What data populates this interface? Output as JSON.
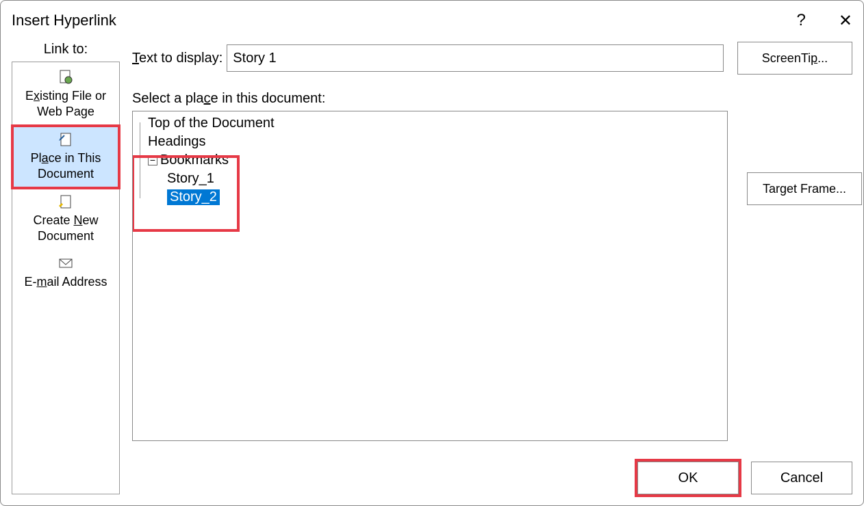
{
  "dialog": {
    "title": "Insert Hyperlink",
    "help_symbol": "?",
    "close_symbol": "✕"
  },
  "sidebar": {
    "label": "Link to:",
    "items": [
      {
        "label_pre": "E",
        "label_u": "x",
        "label_post": "isting File or Web Page"
      },
      {
        "label_pre": "Pl",
        "label_u": "a",
        "label_post": "ce in This Document"
      },
      {
        "label_pre": "Create ",
        "label_u": "N",
        "label_post": "ew Document"
      },
      {
        "label_pre": "E-",
        "label_u": "m",
        "label_post": "ail Address"
      }
    ]
  },
  "main": {
    "text_to_display_pre": "",
    "text_to_display_u": "T",
    "text_to_display_post": "ext to display:",
    "text_to_display_value": "Story 1",
    "screentip_pre": "ScreenTi",
    "screentip_u": "p",
    "screentip_post": "...",
    "select_place_pre": "Select a pla",
    "select_place_u": "c",
    "select_place_post": "e in this document:",
    "target_frame_pre": "Tar",
    "target_frame_u": "g",
    "target_frame_post": "et Frame...",
    "tree": {
      "top": "Top of the Document",
      "headings": "Headings",
      "bookmarks": "Bookmarks",
      "story1": "Story_1",
      "story2": "Story_2"
    }
  },
  "buttons": {
    "ok": "OK",
    "cancel": "Cancel"
  }
}
